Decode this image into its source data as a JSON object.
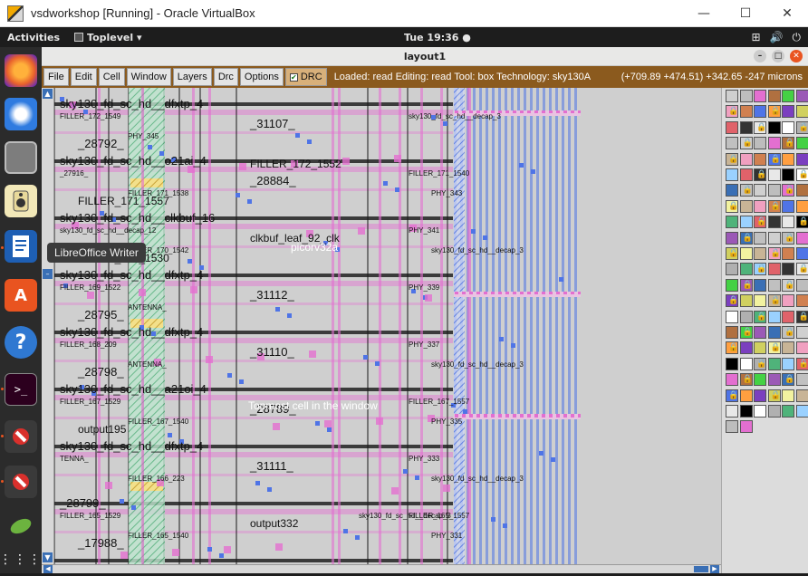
{
  "vbox": {
    "title": "vsdworkshop [Running] - Oracle VirtualBox",
    "minimize": "—",
    "maximize": "☐",
    "close": "✕"
  },
  "ubuntu": {
    "activities": "Activities",
    "toplevel": "Toplevel ▾",
    "clock": "Tue 19:36 ●",
    "tray": [
      "⊞",
      "🔊",
      "⏻"
    ]
  },
  "dock": {
    "tooltip": "LibreOffice Writer",
    "items": [
      "firefox-icon",
      "thunderbird-icon",
      "files-icon",
      "rhythmbox-icon",
      "libreoffice-writer-icon",
      "software-center-icon",
      "help-icon",
      "terminal-icon",
      "no-entry-icon",
      "no-entry-icon",
      "gedit-icon",
      "app-grid-icon"
    ]
  },
  "magic": {
    "window_title": "layout1",
    "menus": [
      "File",
      "Edit",
      "Cell",
      "Window",
      "Layers",
      "Drc",
      "Options"
    ],
    "drc_label": "DRC",
    "status": "Loaded: read  Editing: read  Tool: box   Technology: sky130A",
    "coords": "(+709.89 +474.51) +342.65 -247 microns"
  },
  "canvas": {
    "overlays": {
      "picorv32a": "picorv32a",
      "topmost": "Topmost cell in the window"
    },
    "rows": [
      {
        "big": [
          "sky130_fd_sc_hd__dfxtp_4",
          "_31107_",
          "_28792_",
          "FILLER_172_1552"
        ],
        "small": [
          "FILLER_172_1549",
          "PHY_345",
          "sky130_fd_sc_hd__decap_3"
        ]
      },
      {
        "big": [
          "sky130_fd_sc_hd__o21ai_4",
          "_28884_",
          "FILLER_171_1557"
        ],
        "small": [
          "_27916_",
          "FILLER_171_1538",
          "FILLER_171_1540",
          "PHY_343"
        ]
      },
      {
        "big": [
          "sky130_fd_sc_hd__clkbuf_16",
          "clkbuf_leaf_92_clk",
          "FILLER_170_1530"
        ],
        "small": [
          "sky130_fd_sc_hd__decap_12",
          "FILLER_170_1542",
          "PHY_341",
          "sky130_fd_sc_hd__decap_3"
        ]
      },
      {
        "big": [
          "sky130_fd_sc_hd__dfxtp_4",
          "_31112_",
          "_28795_"
        ],
        "small": [
          "FILLER_169_1522",
          "ANTENNA_",
          "PHY_339"
        ]
      },
      {
        "big": [
          "sky130_fd_sc_hd__dfxtp_4",
          "_31110_",
          "_28798_"
        ],
        "small": [
          "FILLER_168_209",
          "ANTENNA_",
          "PHY_337",
          "sky130_fd_sc_hd__decap_3"
        ]
      },
      {
        "big": [
          "sky130_fd_sc_hd__a21oi_4",
          "_28789_",
          "output195"
        ],
        "small": [
          "FILLER_167_1529",
          "FILLER_167_1540",
          "FILLER_167_1557",
          "PHY_335"
        ]
      },
      {
        "big": [
          "sky130_fd_sc_hd__dfxtp_4",
          "_31111_"
        ],
        "small": [
          "TENNA_",
          "FILLER_166_223",
          "PHY_333",
          "sky130_fd_sc_hd__decap_3"
        ]
      },
      {
        "big": [
          "_28799_",
          "output332",
          "_17988_"
        ],
        "small": [
          "FILLER_165_1529",
          "FILLER_165_1540",
          "FILLER_165_1557",
          "PHY_331",
          "sky130_fd_sc_hd__decap_3"
        ]
      }
    ]
  },
  "colors": {
    "menubar": "#8b5a1e",
    "canvas_bg": "#cfcfcf",
    "metal_pink": "#e36fd0",
    "metal_blue": "#4f74e6",
    "diff_green": "#4fb37a",
    "poly_red": "#e0626a"
  }
}
